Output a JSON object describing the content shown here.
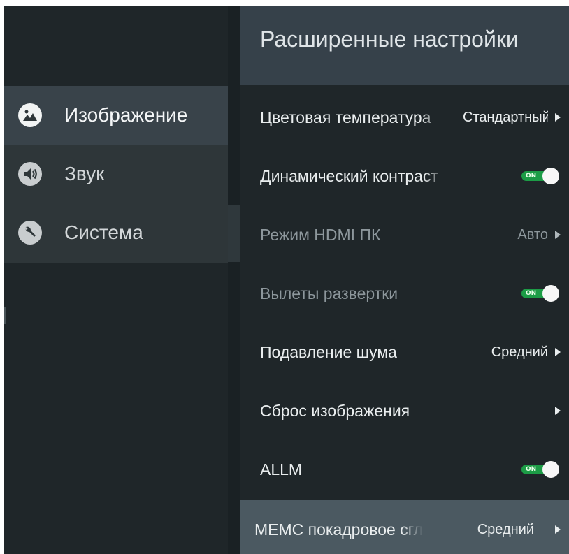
{
  "sidebar": {
    "items": [
      {
        "label": "Изображение",
        "icon": "picture-icon",
        "active": true
      },
      {
        "label": "Звук",
        "icon": "speaker-icon",
        "active": false
      },
      {
        "label": "Система",
        "icon": "wrench-icon",
        "active": false
      }
    ]
  },
  "main": {
    "title": "Расширенные настройки",
    "rows": [
      {
        "label": "Цветовая температура",
        "value": "Стандартный",
        "control": "arrow",
        "enabled": true
      },
      {
        "label": "Динамический контраст",
        "value": "ON",
        "control": "toggle",
        "enabled": true
      },
      {
        "label": "Режим HDMI ПК",
        "value": "Авто",
        "control": "arrow",
        "enabled": false
      },
      {
        "label": "Вылеты развертки",
        "value": "ON",
        "control": "toggle",
        "enabled": false
      },
      {
        "label": "Подавление шума",
        "value": "Средний",
        "control": "arrow",
        "enabled": true
      },
      {
        "label": "Сброс изображения",
        "value": "",
        "control": "arrow",
        "enabled": true
      },
      {
        "label": "ALLM",
        "value": "ON",
        "control": "toggle",
        "enabled": true
      },
      {
        "label": "MEMC покадровое сглаживание",
        "value": "Средний",
        "control": "arrow",
        "enabled": true,
        "focused": true
      }
    ]
  },
  "colors": {
    "background": "#1f2629",
    "sidebar_active": "#39434a",
    "header": "#36414a",
    "focused_row": "#4b5961",
    "toggle_on": "#1c9c46"
  }
}
